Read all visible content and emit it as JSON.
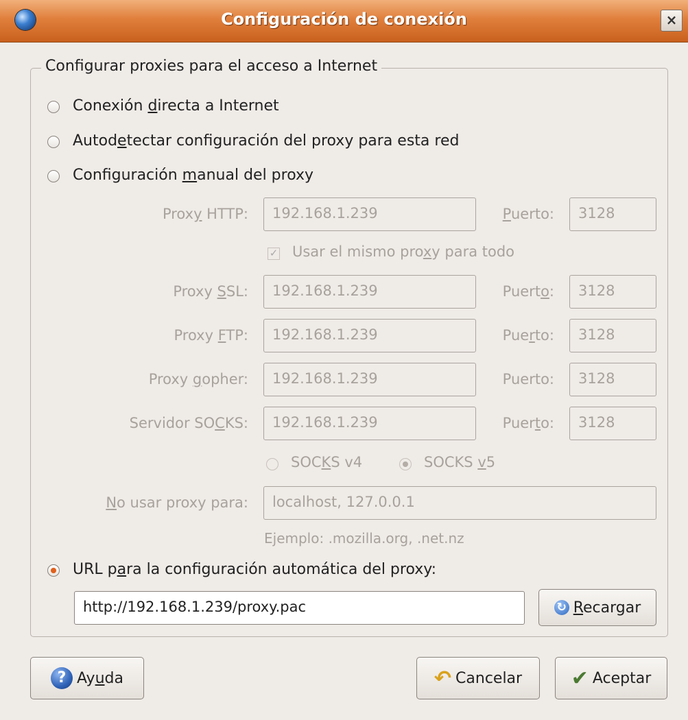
{
  "window": {
    "title": "Configuración de conexión",
    "close_label": "×"
  },
  "group": {
    "legend": "Configurar proxies para el acceso a Internet"
  },
  "options": {
    "direct": {
      "pre": "Conexión ",
      "key": "d",
      "post": "irecta a Internet",
      "selected": false
    },
    "autodetect": {
      "pre": "Autod",
      "key": "e",
      "post": "tectar configuración del proxy para esta red",
      "selected": false
    },
    "manual": {
      "pre": "Configuración ",
      "key": "m",
      "post": "anual del proxy",
      "selected": false
    },
    "auto_url": {
      "pre": "URL p",
      "key": "a",
      "post": "ra la configuración automática del proxy:",
      "selected": true
    }
  },
  "proxies": {
    "http": {
      "label_pre": "Prox",
      "label_key": "y",
      "label_post": " HTTP:",
      "value": "192.168.1.239",
      "port_pre": "",
      "port_key": "P",
      "port_post": "uerto:",
      "port": "3128"
    },
    "ssl": {
      "label_pre": "Proxy ",
      "label_key": "S",
      "label_post": "SL:",
      "value": "192.168.1.239",
      "port_pre": "Puert",
      "port_key": "o",
      "port_post": ":",
      "port": "3128"
    },
    "ftp": {
      "label_pre": "Proxy ",
      "label_key": "F",
      "label_post": "TP:",
      "value": "192.168.1.239",
      "port_pre": "Pue",
      "port_key": "r",
      "port_post": "to:",
      "port": "3128"
    },
    "gopher": {
      "label_pre": "Proxy ",
      "label_key": "g",
      "label_post": "opher:",
      "value": "192.168.1.239",
      "port_pre": "Puerto:",
      "port_key": "",
      "port_post": "",
      "port": "3128"
    },
    "socks": {
      "label_pre": "Servidor SO",
      "label_key": "C",
      "label_post": "KS:",
      "value": "192.168.1.239",
      "port_pre": "Puer",
      "port_key": "t",
      "port_post": "o:",
      "port": "3128"
    }
  },
  "same_proxy": {
    "pre": "Usar el mismo pro",
    "key": "x",
    "post": "y para todo",
    "checked": true,
    "check_mark": "✓"
  },
  "socks_version": {
    "v4": {
      "pre": "SOC",
      "key": "K",
      "post": "S v4",
      "selected": false
    },
    "v5": {
      "pre": "SOCKS ",
      "key": "v",
      "post": "5",
      "selected": true
    }
  },
  "no_proxy": {
    "label_pre": "",
    "label_key": "N",
    "label_post": "o usar proxy para:",
    "value": "localhost, 127.0.0.1",
    "example": "Ejemplo: .mozilla.org, .net.nz"
  },
  "auto_url_value": "http://192.168.1.239/proxy.pac",
  "buttons": {
    "reload": {
      "pre": "",
      "key": "R",
      "post": "ecargar",
      "icon": "reload-icon"
    },
    "help": {
      "pre": "Ay",
      "key": "u",
      "post": "da",
      "icon": "help-icon",
      "glyph": "?"
    },
    "cancel": {
      "label": "Cancelar",
      "icon": "cancel-icon",
      "glyph": "↶"
    },
    "accept": {
      "label": "Aceptar",
      "icon": "accept-icon",
      "glyph": "✔"
    }
  }
}
